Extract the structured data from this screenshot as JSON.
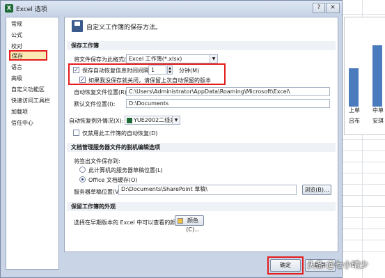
{
  "background": {
    "chart_categories": [
      "上单",
      "中单"
    ],
    "chart_subtext": [
      "吕布",
      "安琪"
    ]
  },
  "window": {
    "title": "Excel 选项",
    "help_glyph": "?",
    "close_glyph": "✕"
  },
  "sidebar": {
    "items": [
      {
        "label": "常规"
      },
      {
        "label": "公式"
      },
      {
        "label": "校对"
      },
      {
        "label": "保存",
        "active": true
      },
      {
        "label": "语言"
      },
      {
        "label": "高级"
      },
      {
        "label": "自定义功能区"
      },
      {
        "label": "快速访问工具栏"
      },
      {
        "label": "加载项"
      },
      {
        "label": "信任中心"
      }
    ]
  },
  "main": {
    "header": "自定义工作簿的保存方法。",
    "save_group": {
      "title": "保存工作簿",
      "format_label": "将文件保存为此格式(F):",
      "format_value": "Excel 工作簿(*.xlsx)",
      "autorecover_label": "保存自动恢复信息时间间隔(A)",
      "autorecover_checked": true,
      "autorecover_minutes": "1",
      "minutes_label": "分钟(M)",
      "keep_last_label": "如果我没保存就关闭，请保留上次自动保留的版本",
      "keep_last_checked": true,
      "autorecover_location_label": "自动恢复文件位置(R):",
      "autorecover_location_value": "C:\\Users\\Administrator\\AppData\\Roaming\\Microsoft\\Excel\\",
      "default_location_label": "默认文件位置(I):",
      "default_location_value": "D:\\Documents"
    },
    "exceptions": {
      "label": "自动恢复例外情况(X):",
      "workbook": "YUE2002二线亮...",
      "disable_label": "仅禁用此工作簿的自动恢复(D)",
      "disable_checked": false
    },
    "offline": {
      "title": "文档管理服务器文件的脱机编辑选项",
      "save_to_label": "将签出文件保存到:",
      "option_server": "此计算机的服务器草稿位置(L)",
      "option_office": "Office 文档缓存(O)",
      "selected": "office",
      "drafts_label": "服务器草稿位置(V):",
      "drafts_value": "D:\\Documents\\SharePoint 草稿\\",
      "browse_button": "浏览(B)..."
    },
    "appearance": {
      "title": "保留工作簿的外观",
      "colors_label": "选择在早期版本的 Excel 中可以查看的颜色:",
      "colors_button": "颜色(C)..."
    }
  },
  "footer": {
    "ok_label": "确定",
    "cancel_label": "取消"
  },
  "watermark": "头条 @七小晴少",
  "colors": {
    "highlight": "#e31c1c",
    "chart_bar": "#4a7bbd",
    "active_item": "#fbe9b5"
  }
}
